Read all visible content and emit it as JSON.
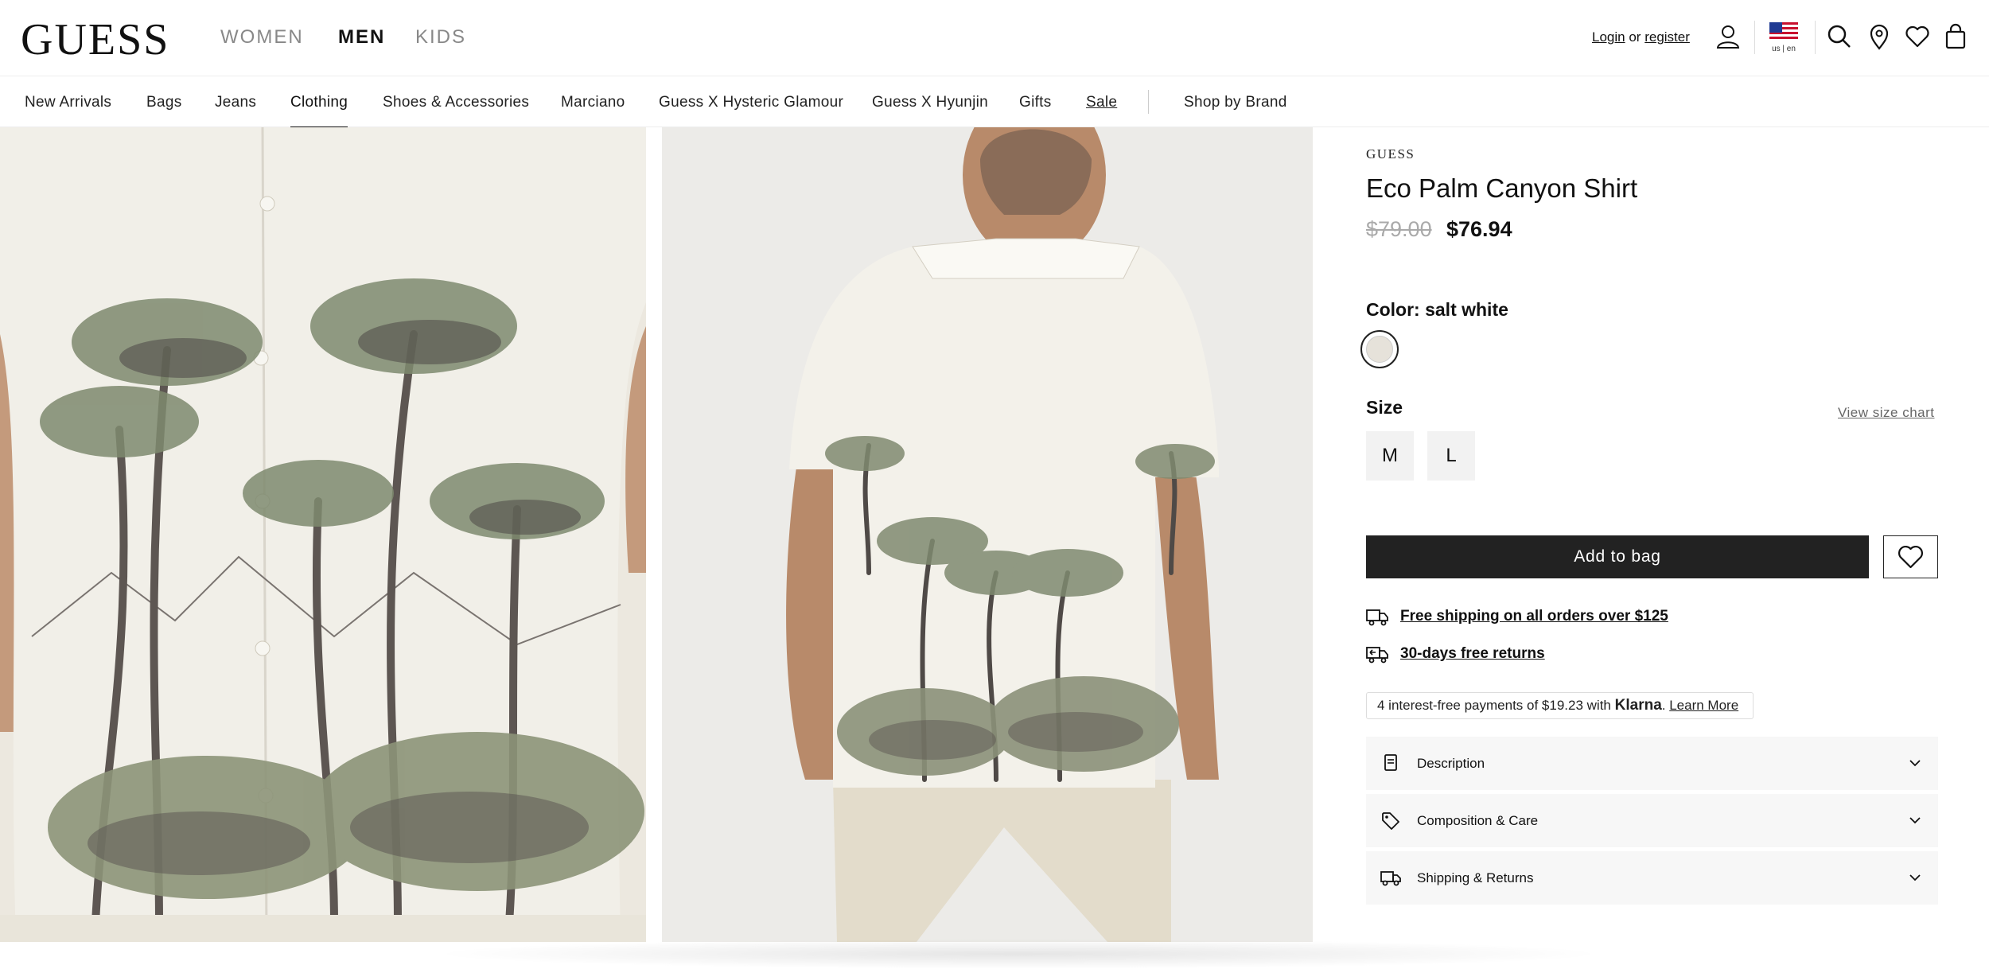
{
  "header": {
    "logo": "GUESS",
    "departments": [
      {
        "label": "WOMEN",
        "active": false
      },
      {
        "label": "MEN",
        "active": true
      },
      {
        "label": "KIDS",
        "active": false
      }
    ],
    "login_label": "Login",
    "or_label": "or",
    "register_label": "register",
    "locale_label": "us | en",
    "icons": [
      "user-icon",
      "us-flag-icon",
      "search-icon",
      "location-pin-icon",
      "heart-icon",
      "bag-icon"
    ]
  },
  "nav": {
    "items": [
      {
        "label": "New Arrivals"
      },
      {
        "label": "Bags"
      },
      {
        "label": "Jeans"
      },
      {
        "label": "Clothing",
        "active": true
      },
      {
        "label": "Shoes & Accessories"
      },
      {
        "label": "Marciano"
      },
      {
        "label": "Guess X Hysteric Glamour"
      },
      {
        "label": "Guess X Hyunjin"
      },
      {
        "label": "Gifts"
      },
      {
        "label": "Sale"
      }
    ],
    "shop_by_brand": "Shop by Brand"
  },
  "product": {
    "brand": "GUESS",
    "title": "Eco Palm Canyon Shirt",
    "price_original": "$79.00",
    "price_sale": "$76.94",
    "color_label": "Color: salt white",
    "color_swatch_hex": "#e6e2da",
    "size_label": "Size",
    "size_chart_label": "View size chart",
    "sizes": [
      "M",
      "L"
    ],
    "add_to_bag_label": "Add to bag",
    "perks": {
      "shipping": "Free shipping on all orders over $125",
      "returns": "30-days free returns"
    },
    "klarna": {
      "text": "4 interest-free payments of $19.23 with",
      "brand": "Klarna",
      "link": "Learn More"
    },
    "accordions": [
      {
        "label": "Description",
        "icon": "document-icon"
      },
      {
        "label": "Composition & Care",
        "icon": "tag-icon"
      },
      {
        "label": "Shipping & Returns",
        "icon": "truck-icon"
      }
    ]
  },
  "colors": {
    "primary_button": "#222222",
    "strike_price": "#aaaaaa",
    "accordion_bg": "#f7f7f7"
  }
}
